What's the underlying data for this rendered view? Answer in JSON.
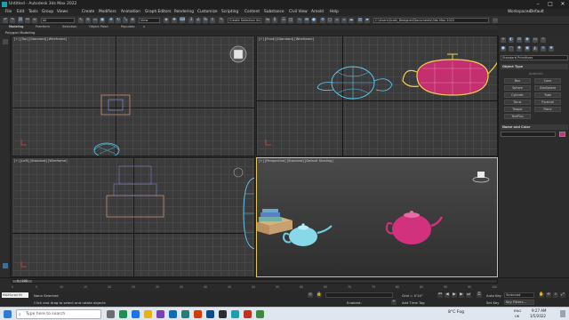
{
  "window": {
    "title": "Untitled - Autodesk 3ds Max 2022",
    "minimize": "–",
    "maximize": "□",
    "close": "✕"
  },
  "menu": [
    "File",
    "Edit",
    "Tools",
    "Group",
    "Views",
    "Create",
    "Modifiers",
    "Animation",
    "Graph Editors",
    "Rendering",
    "Customize",
    "Scripting",
    "Content",
    "Substance",
    "Civil View",
    "Arnold",
    "Help"
  ],
  "workspace": {
    "label": "Workspaces:",
    "value": "Default"
  },
  "toolbar": {
    "selection_filter": "All",
    "view_dropdown": "View",
    "named_selection": "Create Selection Se",
    "project_path": "C:\\Users\\Scott_Designer\\Documents\\3ds Max 2022"
  },
  "ribbon": {
    "tabs": [
      "Modeling",
      "Freeform",
      "Selection",
      "Object Paint",
      "Populate"
    ],
    "sub": "Polygon Modeling"
  },
  "viewports": {
    "top": "[+] [Top] [Standard] [Wireframe]",
    "front": "[+] [Front] [Standard] [Wireframe]",
    "left": "[+] [Left] [Standard] [Wireframe]",
    "perspective": "[+] [Perspective] [Standard] [Default Shading]"
  },
  "command_panel": {
    "category": "Standard Primitives",
    "section": "Object Type",
    "autogrid": "AutoGrid",
    "buttons": [
      "Box",
      "Cone",
      "Sphere",
      "GeoSphere",
      "Cylinder",
      "Tube",
      "Torus",
      "Pyramid",
      "Teapot",
      "Plane",
      "TextPlus"
    ],
    "name_color": "Name and Color",
    "swatch_color": "#c4307f"
  },
  "timeline": {
    "frame_readout": "0 / 100",
    "ticks": [
      "0",
      "5",
      "10",
      "15",
      "20",
      "25",
      "30",
      "35",
      "40",
      "45",
      "50",
      "55",
      "60",
      "65",
      "70",
      "75",
      "80",
      "85",
      "90",
      "95",
      "100"
    ]
  },
  "status": {
    "script_prompt": "MAXScript Mi",
    "selected": "None Selected",
    "hint": "Click and drag to select and rotate objects",
    "grid": "Grid = 0'10\"",
    "enabled": "Enabled:",
    "add_time_tag": "Add Time Tag",
    "auto_key": "Auto Key",
    "set_key": "Set Key",
    "selected_dd": "Selected",
    "key_filters": "Key Filters..."
  },
  "taskbar": {
    "search_placeholder": "Type here to search",
    "weather": "8°C Fog",
    "lang": "ENG",
    "region": "UK",
    "time": "9:27 AM",
    "date": "1/5/2022"
  }
}
